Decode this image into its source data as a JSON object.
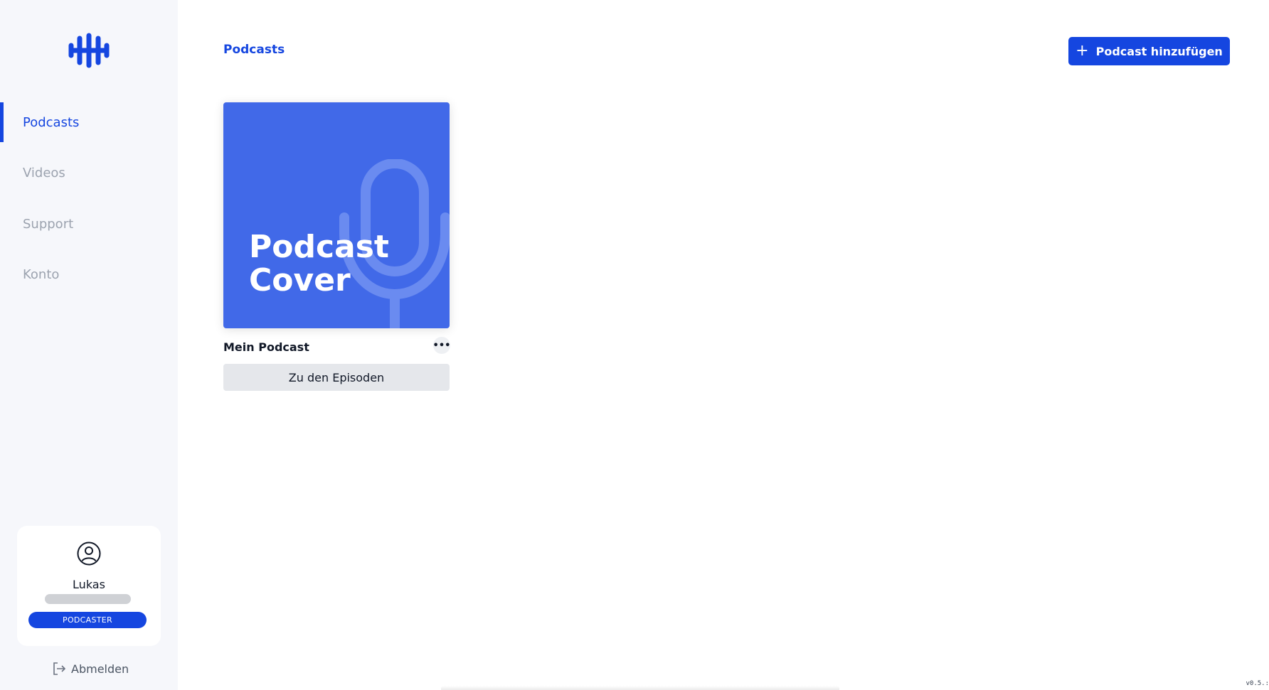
{
  "sidebar": {
    "items": [
      {
        "label": "Podcasts",
        "active": true
      },
      {
        "label": "Videos",
        "active": false
      },
      {
        "label": "Support",
        "active": false
      },
      {
        "label": "Konto",
        "active": false
      }
    ],
    "user": {
      "name": "Lukas",
      "role": "PODCASTER"
    },
    "logout_label": "Abmelden"
  },
  "header": {
    "title": "Podcasts",
    "add_button_label": "Podcast hinzufügen"
  },
  "podcasts": [
    {
      "cover_line1": "Podcast",
      "cover_line2": "Cover",
      "name": "Mein Podcast",
      "episodes_button_label": "Zu den Episoden",
      "more_symbol": "•••"
    }
  ],
  "footer": {
    "version": "v0.5.:"
  },
  "colors": {
    "accent": "#1546e0",
    "cover": "#4169e8",
    "sidebar_bg": "#f6f7fb"
  }
}
